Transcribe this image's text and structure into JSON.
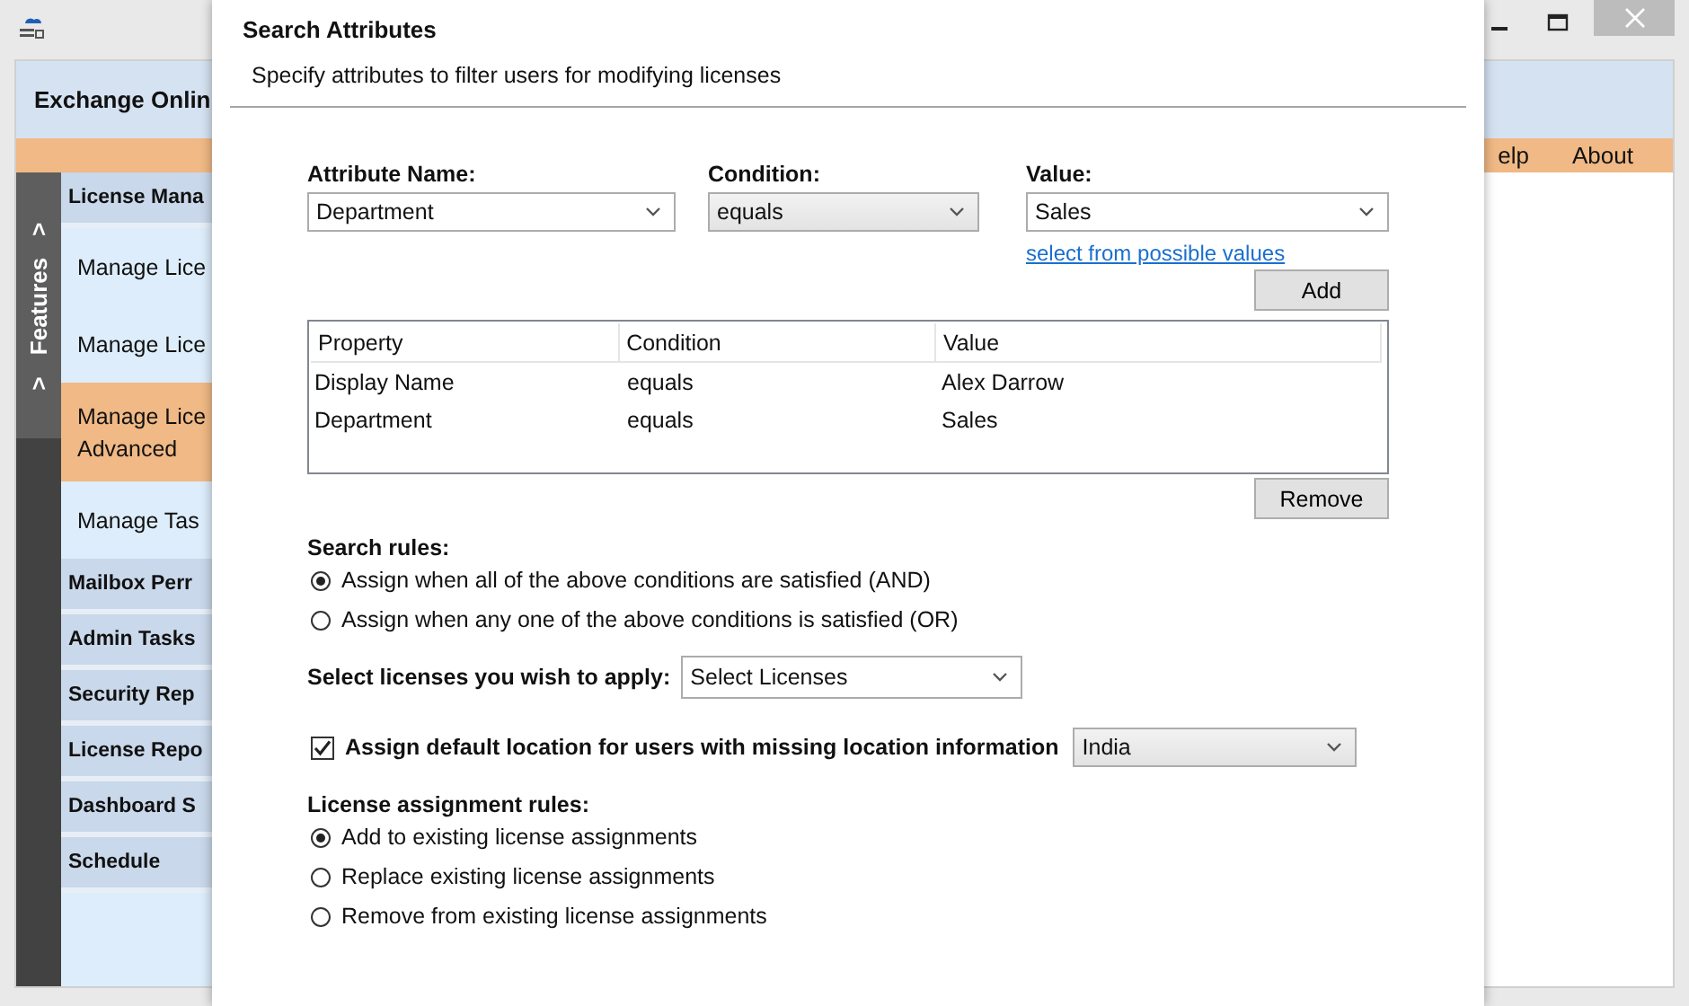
{
  "background_app": {
    "header_title": "Exchange Onlin",
    "menu": [
      "elp",
      "About"
    ],
    "features_tab": {
      "arrow_top": ">",
      "label": "Features",
      "arrow_bottom": ">"
    },
    "sidebar": [
      {
        "label": "License Mana",
        "children": [
          {
            "label": "Manage Lice",
            "selected": false
          },
          {
            "label": "Manage Lice",
            "selected": false
          },
          {
            "label": "Manage Lice\nAdvanced",
            "selected": true
          },
          {
            "label": "Manage Tas",
            "selected": false
          }
        ]
      },
      {
        "label": "Mailbox Perr"
      },
      {
        "label": "Admin Tasks"
      },
      {
        "label": "Security Rep"
      },
      {
        "label": "License Repo"
      },
      {
        "label": "Dashboard S"
      },
      {
        "label": "Schedule"
      }
    ]
  },
  "dialog": {
    "title": "Search Attributes",
    "subtitle": "Specify attributes to filter users for modifying licenses",
    "fields": [
      {
        "label": "Attribute Name:",
        "value": "Department",
        "kind": "editable"
      },
      {
        "label": "Condition:",
        "value": "equals",
        "kind": "list"
      },
      {
        "label": "Value:",
        "value": "Sales",
        "kind": "editable"
      }
    ],
    "value_link": "select from possible values",
    "add_button": "Add",
    "table": {
      "columns": [
        "Property",
        "Condition",
        "Value"
      ],
      "rows": [
        [
          "Display Name",
          "equals",
          "Alex Darrow"
        ],
        [
          "Department",
          "equals",
          "Sales"
        ]
      ]
    },
    "remove_button": "Remove",
    "search_rules": {
      "label": "Search rules:",
      "options": [
        {
          "label": "Assign when all of the above conditions are satisfied (AND)",
          "selected": true
        },
        {
          "label": "Assign when any one of the above conditions is satisfied (OR)",
          "selected": false
        }
      ]
    },
    "licenses": {
      "label": "Select licenses you wish to apply:",
      "value": "Select Licenses"
    },
    "default_location": {
      "label": "Assign default location for users with missing location information",
      "checked": true,
      "value": "India",
      "kind": "list"
    },
    "assignment_rules": {
      "label": "License assignment rules:",
      "options": [
        {
          "label": "Add to existing license assignments",
          "selected": true
        },
        {
          "label": "Replace existing license assignments",
          "selected": false
        },
        {
          "label": "Remove from existing license assignments",
          "selected": false
        }
      ]
    }
  }
}
